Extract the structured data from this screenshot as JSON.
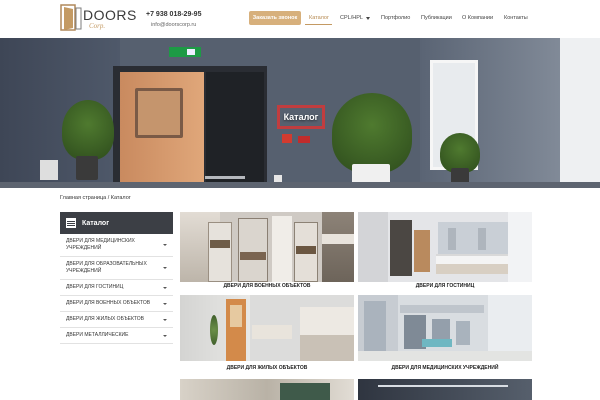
{
  "header": {
    "logo_text": "DOORS",
    "logo_sub": "Corp.",
    "phone": "+7 938 018-29-95",
    "email": "info@doorscorp.ru",
    "cta_label": "Заказать звонок",
    "nav": [
      {
        "label": "Каталог",
        "active": true
      },
      {
        "label": "CPL/HPL",
        "has_dropdown": true
      },
      {
        "label": "Портфолио"
      },
      {
        "label": "Публикации"
      },
      {
        "label": "О Компании"
      },
      {
        "label": "Контакты"
      }
    ],
    "brand_color": "#c49a63"
  },
  "hero": {
    "title": "Каталог",
    "exit_sign": "Exit"
  },
  "breadcrumb": {
    "home": "Главная страница",
    "separator": " / ",
    "current": "Каталог"
  },
  "sidebar": {
    "title": "Каталог",
    "items": [
      {
        "label": "Двери для медицинских учреждений"
      },
      {
        "label": "Двери для образовательных учреждений"
      },
      {
        "label": "Двери для гостиниц"
      },
      {
        "label": "Двери для военных объектов"
      },
      {
        "label": "Двери для жилых объектов"
      },
      {
        "label": "Двери металлические"
      }
    ]
  },
  "catalog": {
    "cards": [
      {
        "label": "Двери для военных объектов"
      },
      {
        "label": "Двери для гостиниц"
      },
      {
        "label": "Двери для жилых объектов"
      },
      {
        "label": "Двери для медицинских учреждений"
      }
    ]
  }
}
